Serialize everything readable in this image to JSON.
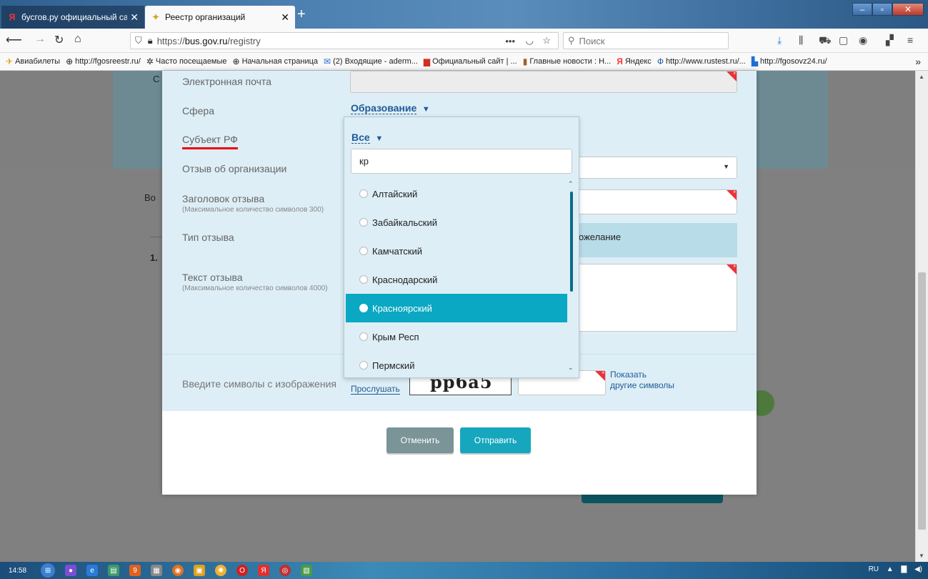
{
  "browser": {
    "tabs": [
      {
        "label": "бусгов.ру официальный сайт",
        "favicon": "yandex-icon",
        "active": false
      },
      {
        "label": "Реестр организаций",
        "favicon": "emblem-icon",
        "active": true
      }
    ],
    "url": {
      "scheme": "https://",
      "host": "bus.gov.ru",
      "path": "/registry"
    },
    "search_placeholder": "Поиск",
    "bookmarks": [
      "Авиабилеты",
      "http://fgosreestr.ru/",
      "Часто посещаемые",
      "Начальная страница",
      "(2) Входящие - aderm...",
      "Официальный сайт | ...",
      "Главные новости : Н...",
      "Яндекс",
      "http://www.rustest.ru/...",
      "http://fgosovz24.ru/"
    ]
  },
  "background": {
    "left_letters_1": "С",
    "left_letters_2": "Во",
    "left_num": "1."
  },
  "form": {
    "email_label": "Электронная почта",
    "sphere_label": "Сфера",
    "sphere_value": "Образование",
    "subject_label": "Субъект РФ",
    "review_org_label": "Отзыв об организации",
    "review_title_label": "Заголовок отзыва",
    "review_title_hint": "(Максимальное количество символов 300)",
    "review_type_label": "Тип отзыва",
    "review_type_value": "ожелание",
    "review_text_label": "Текст отзыва",
    "review_text_hint": "(Максимальное количество символов 4000)"
  },
  "dropdown": {
    "all_label": "Все",
    "search_value": "кр",
    "items": [
      {
        "label": "Алтайский",
        "selected": false
      },
      {
        "label": "Забайкальский",
        "selected": false
      },
      {
        "label": "Камчатский",
        "selected": false
      },
      {
        "label": "Краснодарский",
        "selected": false
      },
      {
        "label": "Красноярский",
        "selected": true
      },
      {
        "label": "Крым Респ",
        "selected": false
      },
      {
        "label": "Пермский",
        "selected": false
      }
    ]
  },
  "captcha": {
    "label": "Введите символы с изображения",
    "listen": "Прослушать",
    "image_text": "pp6a5",
    "other_line1": "Показать",
    "other_line2": "другие символы"
  },
  "buttons": {
    "cancel": "Отменить",
    "send": "Отправить"
  },
  "taskbar": {
    "time": "14:58",
    "lang": "RU"
  },
  "colors": {
    "accent": "#0aa8c2",
    "link": "#1f5a96",
    "required": "#e8343a",
    "form_bg": "#ddeef6"
  }
}
